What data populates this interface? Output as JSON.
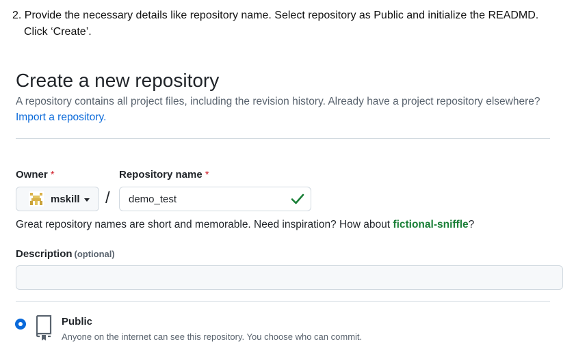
{
  "instruction": {
    "line1": "2. Provide the necessary details like repository name. Select repository as Public and initialize the READMD.",
    "line2": "Click ‘Create’."
  },
  "header": {
    "title": "Create a new repository",
    "subtitle": "A repository contains all project files, including the revision history. Already have a project repository elsewhere?",
    "import_link": "Import a repository."
  },
  "form": {
    "owner_label": "Owner",
    "required_mark": "*",
    "owner_value": "mskill",
    "separator": "/",
    "repo_label": "Repository name",
    "repo_value": "demo_test",
    "hint_text": "Great repository names are short and memorable. Need inspiration? How about ",
    "hint_suggestion": "fictional-sniffle",
    "hint_end": "?",
    "description_label": "Description",
    "description_optional": "(optional)",
    "description_value": ""
  },
  "visibility": {
    "selected": true,
    "title": "Public",
    "description": "Anyone on the internet can see this repository. You choose who can commit."
  },
  "colors": {
    "link": "#0969da",
    "success": "#1a7f37",
    "required": "#d1242f",
    "radio": "#0969da"
  }
}
